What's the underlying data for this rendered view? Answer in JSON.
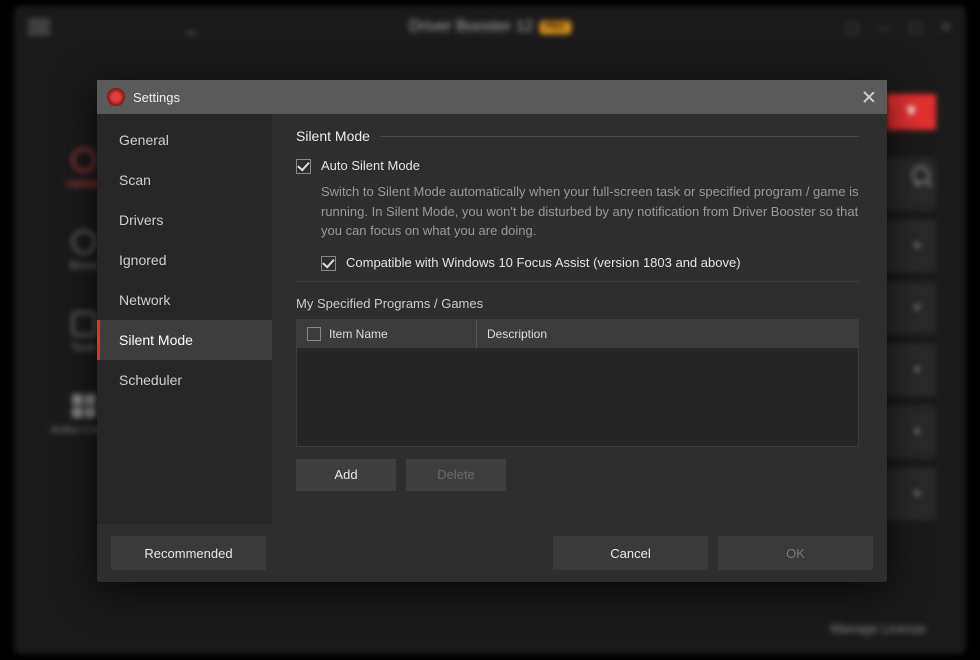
{
  "main_window": {
    "title": "Driver Booster 12",
    "edition_badge": "PRO",
    "side_items": [
      "Update",
      "Boost",
      "Tools",
      "Action Center"
    ],
    "manage_license": "Manage License"
  },
  "dialog": {
    "title": "Settings",
    "nav": [
      {
        "label": "General"
      },
      {
        "label": "Scan"
      },
      {
        "label": "Drivers"
      },
      {
        "label": "Ignored"
      },
      {
        "label": "Network"
      },
      {
        "label": "Silent Mode",
        "active": true
      },
      {
        "label": "Scheduler"
      }
    ],
    "section_title": "Silent Mode",
    "auto_silent": {
      "checked": true,
      "label": "Auto Silent Mode",
      "description": "Switch to Silent Mode automatically when your full-screen task or specified program / game is running. In Silent Mode, you won't be disturbed by any notification from Driver Booster so that you can focus on what you are doing."
    },
    "focus_assist": {
      "checked": true,
      "label": "Compatible with Windows 10 Focus Assist (version 1803 and above)"
    },
    "programs_section_label": "My Specified Programs / Games",
    "table": {
      "col1": "Item Name",
      "col2": "Description",
      "rows": []
    },
    "buttons": {
      "add": "Add",
      "delete": "Delete"
    },
    "footer": {
      "recommended": "Recommended",
      "cancel": "Cancel",
      "ok": "OK"
    }
  }
}
